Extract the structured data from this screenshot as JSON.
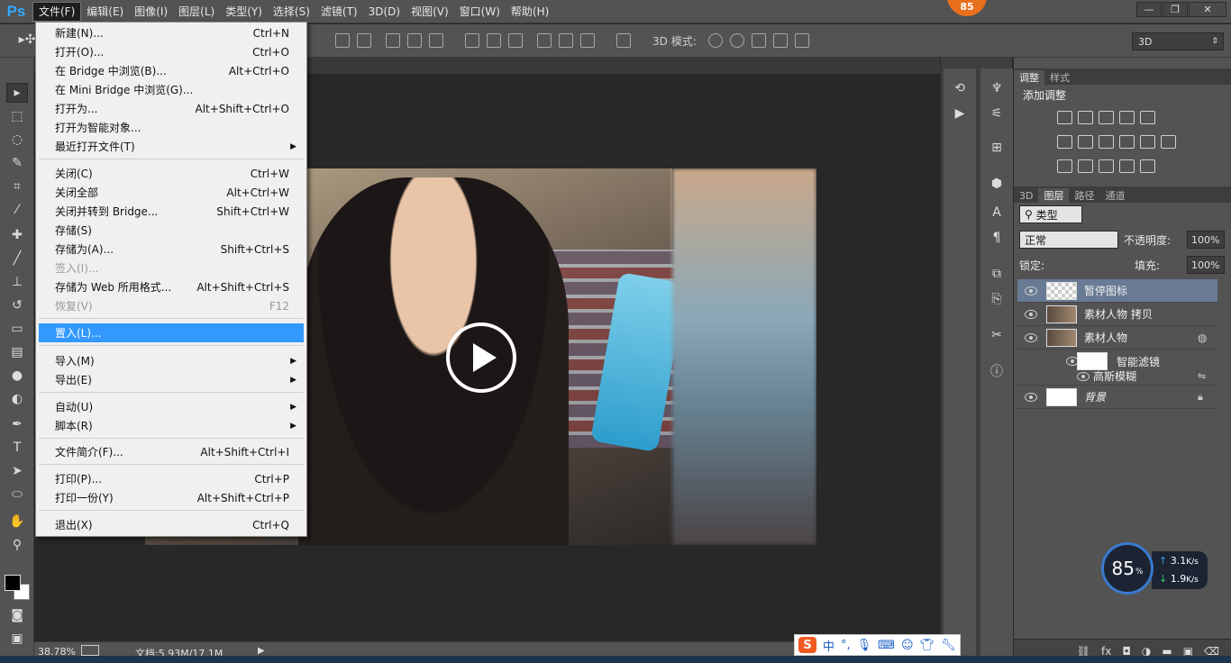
{
  "app": {
    "logo": "Ps",
    "badge": "85"
  },
  "menubar": {
    "items": [
      "文件(F)",
      "编辑(E)",
      "图像(I)",
      "图层(L)",
      "类型(Y)",
      "选择(S)",
      "滤镜(T)",
      "3D(D)",
      "视图(V)",
      "窗口(W)",
      "帮助(H)"
    ]
  },
  "window_controls": {
    "minimize": "—",
    "restore": "❐",
    "close": "✕"
  },
  "options_bar": {
    "mode_label": "3D 模式:",
    "workspace": "3D"
  },
  "file_menu": {
    "items": [
      {
        "label": "新建(N)...",
        "shortcut": "Ctrl+N"
      },
      {
        "label": "打开(O)...",
        "shortcut": "Ctrl+O"
      },
      {
        "label": "在 Bridge 中浏览(B)...",
        "shortcut": "Alt+Ctrl+O"
      },
      {
        "label": "在 Mini Bridge 中浏览(G)...",
        "shortcut": ""
      },
      {
        "label": "打开为...",
        "shortcut": "Alt+Shift+Ctrl+O"
      },
      {
        "label": "打开为智能对象...",
        "shortcut": ""
      },
      {
        "label": "最近打开文件(T)",
        "shortcut": ""
      },
      {
        "label": "关闭(C)",
        "shortcut": "Ctrl+W"
      },
      {
        "label": "关闭全部",
        "shortcut": "Alt+Ctrl+W"
      },
      {
        "label": "关闭并转到 Bridge...",
        "shortcut": "Shift+Ctrl+W"
      },
      {
        "label": "存储(S)",
        "shortcut": ""
      },
      {
        "label": "存储为(A)...",
        "shortcut": "Shift+Ctrl+S"
      },
      {
        "label": "签入(I)...",
        "shortcut": ""
      },
      {
        "label": "存储为 Web 所用格式...",
        "shortcut": "Alt+Shift+Ctrl+S"
      },
      {
        "label": "恢复(V)",
        "shortcut": "F12"
      },
      {
        "label": "置入(L)...",
        "shortcut": ""
      },
      {
        "label": "导入(M)",
        "shortcut": ""
      },
      {
        "label": "导出(E)",
        "shortcut": ""
      },
      {
        "label": "自动(U)",
        "shortcut": ""
      },
      {
        "label": "脚本(R)",
        "shortcut": ""
      },
      {
        "label": "文件简介(F)...",
        "shortcut": "Alt+Shift+Ctrl+I"
      },
      {
        "label": "打印(P)...",
        "shortcut": "Ctrl+P"
      },
      {
        "label": "打印一份(Y)",
        "shortcut": "Alt+Shift+Ctrl+P"
      },
      {
        "label": "退出(X)",
        "shortcut": "Ctrl+Q"
      }
    ]
  },
  "status_bar": {
    "zoom": "38.78%",
    "doc_info": "文档:5.93M/17.1M"
  },
  "adjustments_panel": {
    "tabs": [
      "调整",
      "样式"
    ],
    "title": "添加调整"
  },
  "layers_panel": {
    "tabs": [
      "3D",
      "图层",
      "路径",
      "通道"
    ],
    "filter_kind": "类型",
    "blend_mode": "正常",
    "opacity_label": "不透明度:",
    "opacity": "100%",
    "lock_label": "锁定:",
    "fill_label": "填充:",
    "fill": "100%",
    "layers": [
      {
        "name": "暂停图标"
      },
      {
        "name": "素材人物 拷贝"
      },
      {
        "name": "素材人物"
      },
      {
        "name": "智能滤镜"
      },
      {
        "name": "高斯模糊"
      },
      {
        "name": "背景"
      }
    ],
    "bottom_icons": "fx"
  },
  "speed_widget": {
    "percent": "85",
    "unit": "%",
    "upload": "3.1",
    "upload_unit": "K/s",
    "download": "1.9",
    "download_unit": "K/s"
  },
  "ime": {
    "logo": "S",
    "mode": "中",
    "punct": "°,"
  }
}
